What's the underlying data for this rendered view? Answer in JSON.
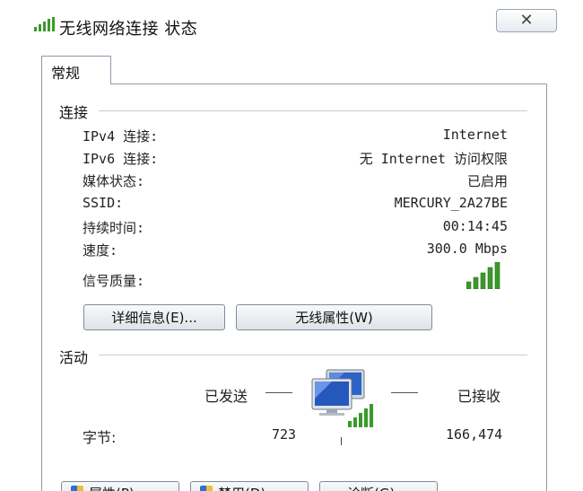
{
  "window": {
    "title": "无线网络连接 状态",
    "close_symbol": "✕"
  },
  "tabs": [
    {
      "label": "常规"
    }
  ],
  "connection": {
    "group_title": "连接",
    "rows": [
      {
        "label": "IPv4 连接:",
        "value": "Internet"
      },
      {
        "label": "IPv6 连接:",
        "value": "无 Internet 访问权限"
      },
      {
        "label": "媒体状态:",
        "value": "已启用"
      },
      {
        "label": "SSID:",
        "value": "MERCURY_2A27BE"
      },
      {
        "label": "持续时间:",
        "value": "00:14:45"
      },
      {
        "label": "速度:",
        "value": "300.0 Mbps"
      }
    ],
    "signal_label": "信号质量:",
    "signal_bars": 5,
    "details_button": "详细信息(E)...",
    "wireless_props_button": "无线属性(W)"
  },
  "activity": {
    "group_title": "活动",
    "sent_label": "已发送",
    "received_label": "已接收",
    "bytes_label": "字节:",
    "bytes_sent": "723",
    "bytes_received": "166,474"
  },
  "bottom_buttons": [
    {
      "label": "属性(P)"
    },
    {
      "label": "禁用(D)"
    },
    {
      "label": "诊断(G)"
    }
  ],
  "colors": {
    "signal_green": "#3a9a2a",
    "border": "#8e9aa8",
    "button_top": "#f8f9fa",
    "button_bottom": "#dfe3e8"
  }
}
